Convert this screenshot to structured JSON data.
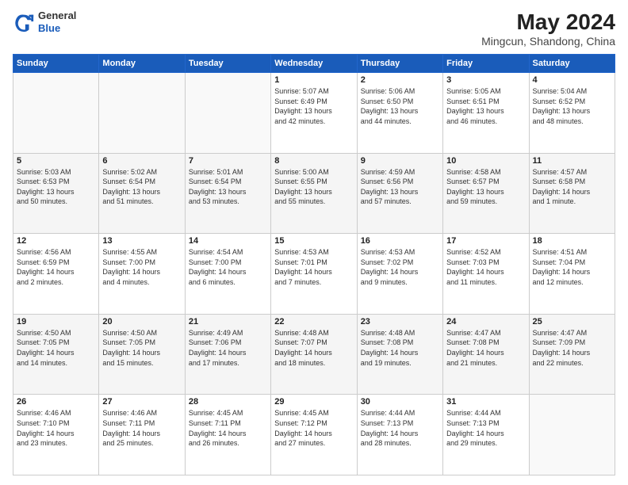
{
  "logo": {
    "general": "General",
    "blue": "Blue"
  },
  "header": {
    "title": "May 2024",
    "subtitle": "Mingcun, Shandong, China"
  },
  "days_of_week": [
    "Sunday",
    "Monday",
    "Tuesday",
    "Wednesday",
    "Thursday",
    "Friday",
    "Saturday"
  ],
  "weeks": [
    [
      {
        "day": "",
        "info": ""
      },
      {
        "day": "",
        "info": ""
      },
      {
        "day": "",
        "info": ""
      },
      {
        "day": "1",
        "info": "Sunrise: 5:07 AM\nSunset: 6:49 PM\nDaylight: 13 hours\nand 42 minutes."
      },
      {
        "day": "2",
        "info": "Sunrise: 5:06 AM\nSunset: 6:50 PM\nDaylight: 13 hours\nand 44 minutes."
      },
      {
        "day": "3",
        "info": "Sunrise: 5:05 AM\nSunset: 6:51 PM\nDaylight: 13 hours\nand 46 minutes."
      },
      {
        "day": "4",
        "info": "Sunrise: 5:04 AM\nSunset: 6:52 PM\nDaylight: 13 hours\nand 48 minutes."
      }
    ],
    [
      {
        "day": "5",
        "info": "Sunrise: 5:03 AM\nSunset: 6:53 PM\nDaylight: 13 hours\nand 50 minutes."
      },
      {
        "day": "6",
        "info": "Sunrise: 5:02 AM\nSunset: 6:54 PM\nDaylight: 13 hours\nand 51 minutes."
      },
      {
        "day": "7",
        "info": "Sunrise: 5:01 AM\nSunset: 6:54 PM\nDaylight: 13 hours\nand 53 minutes."
      },
      {
        "day": "8",
        "info": "Sunrise: 5:00 AM\nSunset: 6:55 PM\nDaylight: 13 hours\nand 55 minutes."
      },
      {
        "day": "9",
        "info": "Sunrise: 4:59 AM\nSunset: 6:56 PM\nDaylight: 13 hours\nand 57 minutes."
      },
      {
        "day": "10",
        "info": "Sunrise: 4:58 AM\nSunset: 6:57 PM\nDaylight: 13 hours\nand 59 minutes."
      },
      {
        "day": "11",
        "info": "Sunrise: 4:57 AM\nSunset: 6:58 PM\nDaylight: 14 hours\nand 1 minute."
      }
    ],
    [
      {
        "day": "12",
        "info": "Sunrise: 4:56 AM\nSunset: 6:59 PM\nDaylight: 14 hours\nand 2 minutes."
      },
      {
        "day": "13",
        "info": "Sunrise: 4:55 AM\nSunset: 7:00 PM\nDaylight: 14 hours\nand 4 minutes."
      },
      {
        "day": "14",
        "info": "Sunrise: 4:54 AM\nSunset: 7:00 PM\nDaylight: 14 hours\nand 6 minutes."
      },
      {
        "day": "15",
        "info": "Sunrise: 4:53 AM\nSunset: 7:01 PM\nDaylight: 14 hours\nand 7 minutes."
      },
      {
        "day": "16",
        "info": "Sunrise: 4:53 AM\nSunset: 7:02 PM\nDaylight: 14 hours\nand 9 minutes."
      },
      {
        "day": "17",
        "info": "Sunrise: 4:52 AM\nSunset: 7:03 PM\nDaylight: 14 hours\nand 11 minutes."
      },
      {
        "day": "18",
        "info": "Sunrise: 4:51 AM\nSunset: 7:04 PM\nDaylight: 14 hours\nand 12 minutes."
      }
    ],
    [
      {
        "day": "19",
        "info": "Sunrise: 4:50 AM\nSunset: 7:05 PM\nDaylight: 14 hours\nand 14 minutes."
      },
      {
        "day": "20",
        "info": "Sunrise: 4:50 AM\nSunset: 7:05 PM\nDaylight: 14 hours\nand 15 minutes."
      },
      {
        "day": "21",
        "info": "Sunrise: 4:49 AM\nSunset: 7:06 PM\nDaylight: 14 hours\nand 17 minutes."
      },
      {
        "day": "22",
        "info": "Sunrise: 4:48 AM\nSunset: 7:07 PM\nDaylight: 14 hours\nand 18 minutes."
      },
      {
        "day": "23",
        "info": "Sunrise: 4:48 AM\nSunset: 7:08 PM\nDaylight: 14 hours\nand 19 minutes."
      },
      {
        "day": "24",
        "info": "Sunrise: 4:47 AM\nSunset: 7:08 PM\nDaylight: 14 hours\nand 21 minutes."
      },
      {
        "day": "25",
        "info": "Sunrise: 4:47 AM\nSunset: 7:09 PM\nDaylight: 14 hours\nand 22 minutes."
      }
    ],
    [
      {
        "day": "26",
        "info": "Sunrise: 4:46 AM\nSunset: 7:10 PM\nDaylight: 14 hours\nand 23 minutes."
      },
      {
        "day": "27",
        "info": "Sunrise: 4:46 AM\nSunset: 7:11 PM\nDaylight: 14 hours\nand 25 minutes."
      },
      {
        "day": "28",
        "info": "Sunrise: 4:45 AM\nSunset: 7:11 PM\nDaylight: 14 hours\nand 26 minutes."
      },
      {
        "day": "29",
        "info": "Sunrise: 4:45 AM\nSunset: 7:12 PM\nDaylight: 14 hours\nand 27 minutes."
      },
      {
        "day": "30",
        "info": "Sunrise: 4:44 AM\nSunset: 7:13 PM\nDaylight: 14 hours\nand 28 minutes."
      },
      {
        "day": "31",
        "info": "Sunrise: 4:44 AM\nSunset: 7:13 PM\nDaylight: 14 hours\nand 29 minutes."
      },
      {
        "day": "",
        "info": ""
      }
    ]
  ]
}
